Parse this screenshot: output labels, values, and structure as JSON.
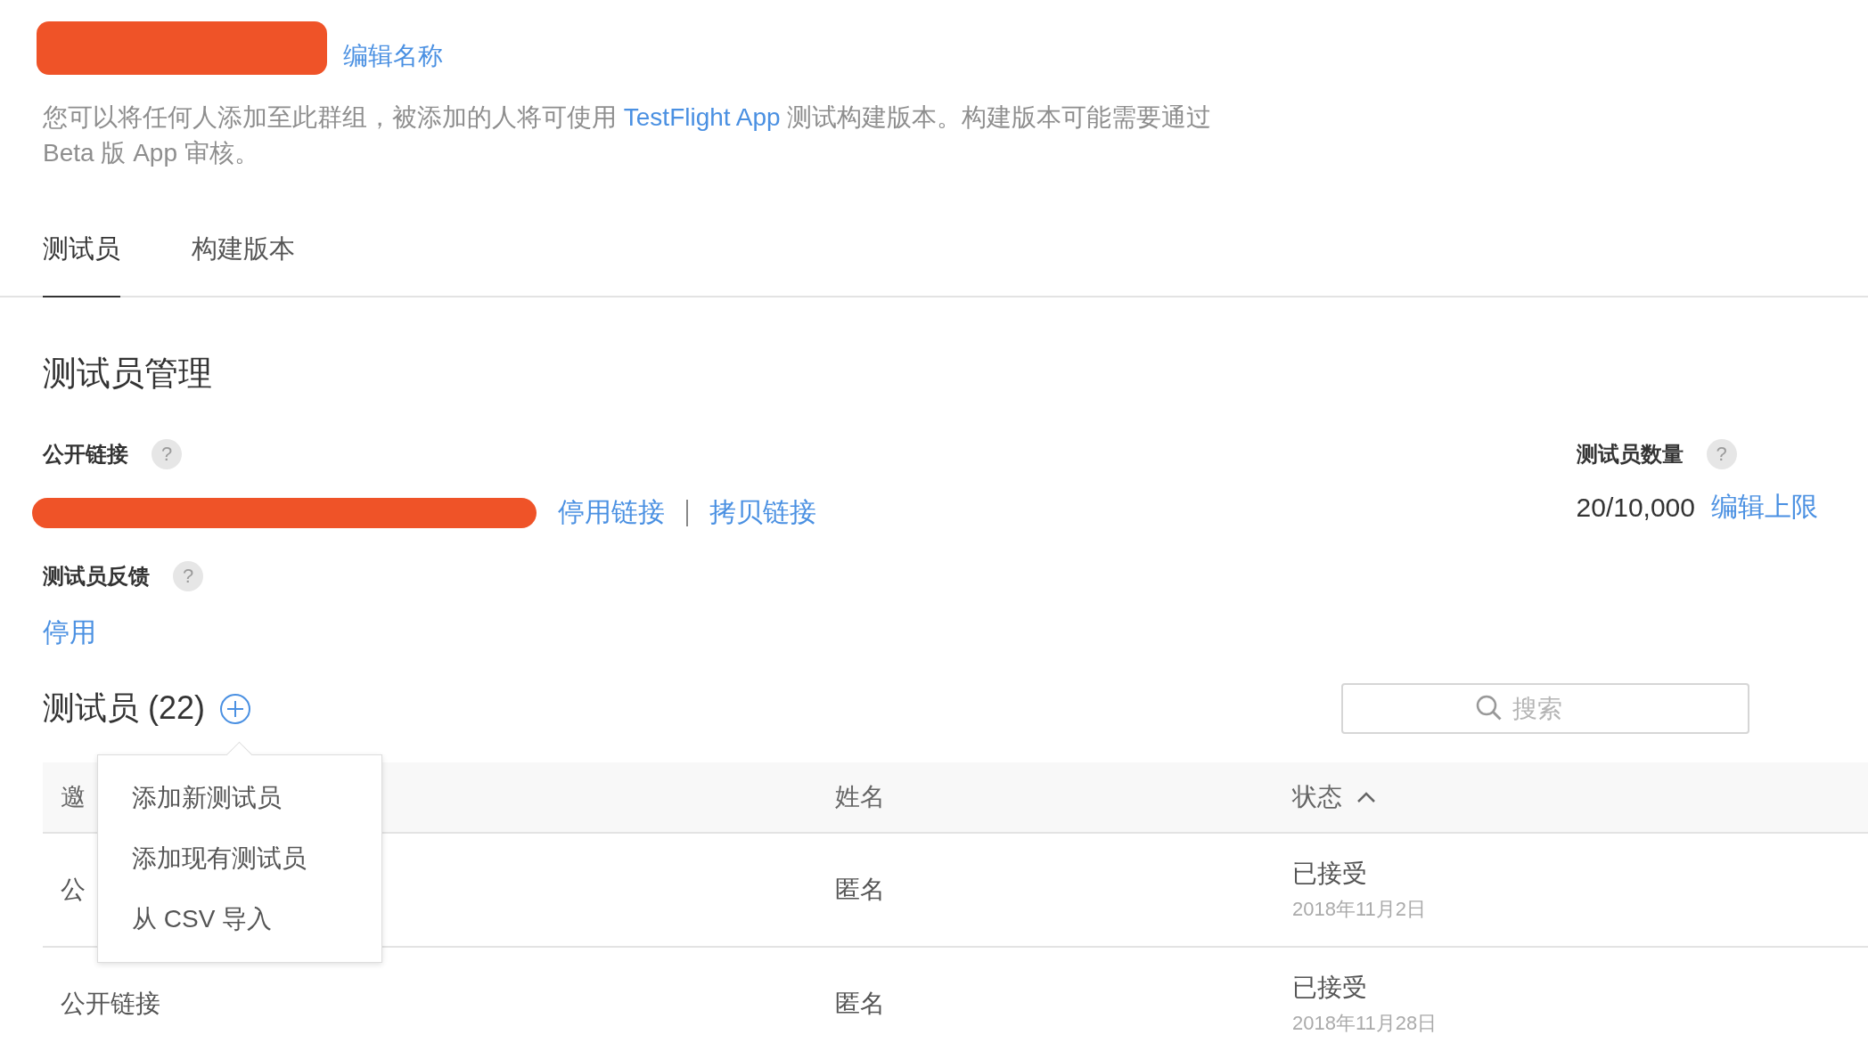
{
  "header": {
    "edit_name_link": "编辑名称",
    "description": [
      "您可以将任何人添加至此群组，被添加的人将可使用 ",
      "TestFlight App",
      " 测试构建版本。构建版本可能需要通过",
      "Beta 版 App 审核。"
    ]
  },
  "tabs": [
    {
      "label": "测试员",
      "selected": true
    },
    {
      "label": "构建版本",
      "selected": false
    }
  ],
  "section_title": "测试员管理",
  "public_link": {
    "label": "公开链接",
    "help": "?",
    "actions": [
      "停用链接",
      "拷贝链接"
    ]
  },
  "tester_count": {
    "label": "测试员数量",
    "help": "?",
    "value": "20/10,000",
    "action": "编辑上限"
  },
  "feedback": {
    "label": "测试员反馈",
    "help": "?",
    "action": "停用"
  },
  "testers": {
    "title": "测试员 (22)",
    "search": {
      "placeholder": "搜索"
    },
    "menu": {
      "open": true,
      "items": [
        "添加新测试员",
        "添加现有测试员",
        "从 CSV 导入"
      ]
    },
    "columns": [
      {
        "label": "邀",
        "sorted": false
      },
      {
        "label": "姓名",
        "sorted": false
      },
      {
        "label": "状态",
        "sorted": true
      }
    ],
    "rows": [
      {
        "source": "公",
        "name": "匿名",
        "status": "已接受",
        "date": "2018年11月2日"
      },
      {
        "source": "公开链接",
        "name": "匿名",
        "status": "已接受",
        "date": "2018年11月28日"
      }
    ]
  }
}
